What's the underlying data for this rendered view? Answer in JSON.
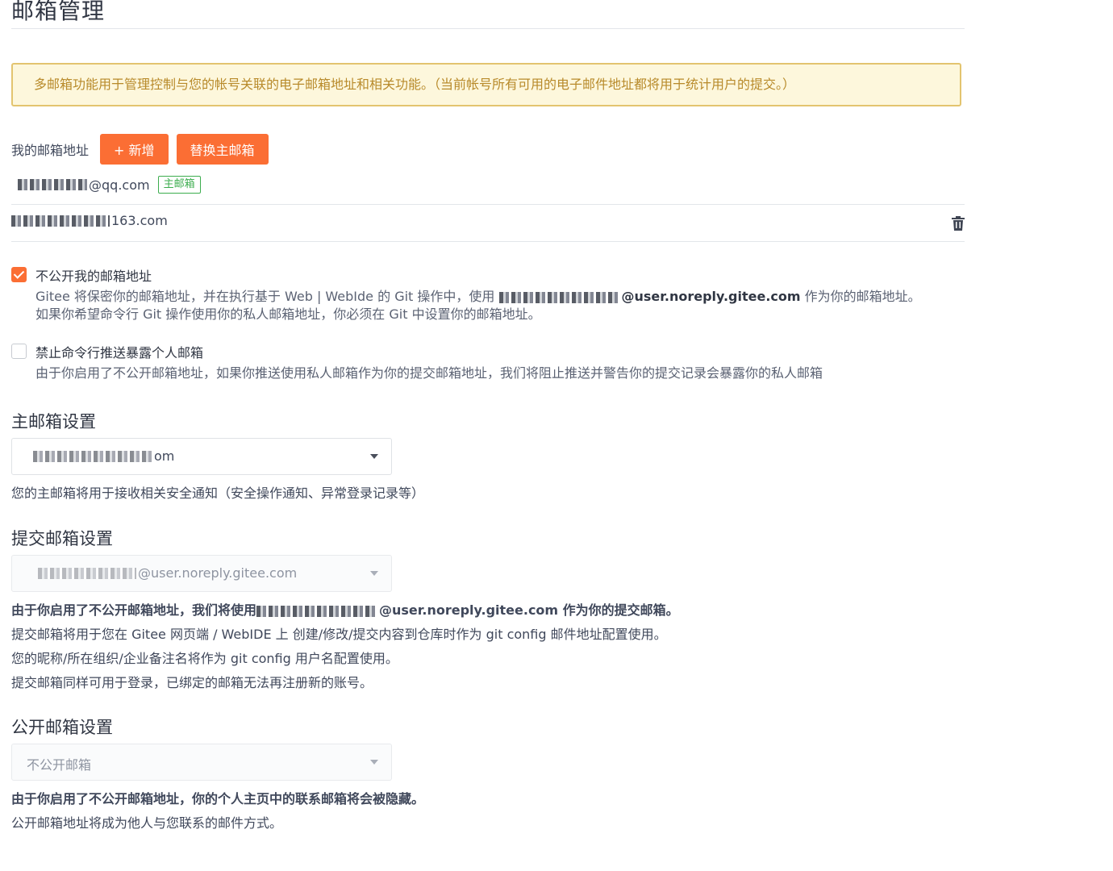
{
  "page": {
    "title": "邮箱管理"
  },
  "notice": "多邮箱功能用于管理控制与您的帐号关联的电子邮箱地址和相关功能。（当前帐号所有可用的电子邮件地址都将用于统计用户的提交。）",
  "emails": {
    "label": "我的邮箱地址",
    "add_button": "+ 新增",
    "replace_button": "替换主邮箱",
    "list": [
      {
        "suffix": "@qq.com",
        "badge": "主邮箱"
      },
      {
        "suffix": "163.com"
      }
    ]
  },
  "privacy": {
    "hide_email": {
      "checked": true,
      "title": "不公开我的邮箱地址",
      "desc_line1_prefix": "Gitee 将保密你的邮箱地址，并在执行基于 Web | WebIde 的 Git 操作中，使用",
      "desc_line1_email": "@user.noreply.gitee.com",
      "desc_line1_suffix": " 作为你的邮箱地址。",
      "desc_line2": "如果你希望命令行 Git 操作使用你的私人邮箱地址，你必须在 Git 中设置你的邮箱地址。"
    },
    "block_push": {
      "checked": false,
      "title": "禁止命令行推送暴露个人邮箱",
      "desc": "由于你启用了不公开邮箱地址，如果你推送使用私人邮箱作为你的提交邮箱地址，我们将阻止推送并警告你的提交记录会暴露你的私人邮箱"
    }
  },
  "primary_setting": {
    "title": "主邮箱设置",
    "selected_suffix": "om",
    "hint": "您的主邮箱将用于接收相关安全通知（安全操作通知、异常登录记录等）"
  },
  "commit_setting": {
    "title": "提交邮箱设置",
    "selected_suffix": "@user.noreply.gitee.com",
    "line1_prefix": "由于你启用了不公开邮箱地址，我们将使用",
    "line1_email": "@user.noreply.gitee.com",
    "line1_suffix": " 作为你的提交邮箱。",
    "line2": "提交邮箱将用于您在 Gitee 网页端 / WebIDE 上 创建/修改/提交内容到仓库时作为 git config 邮件地址配置使用。",
    "line3": "您的昵称/所在组织/企业备注名将作为 git config 用户名配置使用。",
    "line4": "提交邮箱同样可用于登录，已绑定的邮箱无法再注册新的账号。"
  },
  "public_setting": {
    "title": "公开邮箱设置",
    "selected": "不公开邮箱",
    "line1": "由于你启用了不公开邮箱地址，你的个人主页中的联系邮箱将会被隐藏。",
    "line2": "公开邮箱地址将成为他人与您联系的邮件方式。"
  }
}
